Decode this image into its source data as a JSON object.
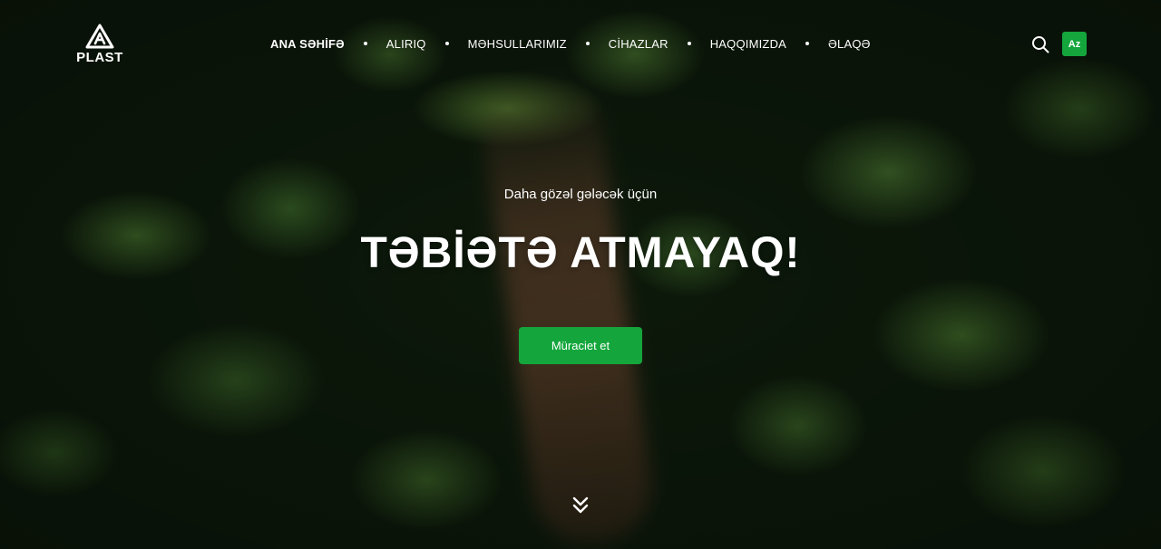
{
  "brand": {
    "name": "PLAST",
    "logo_icon": "recycle-a-triangle-icon"
  },
  "nav": {
    "items": [
      {
        "label": "ANA SƏHİFƏ",
        "active": true
      },
      {
        "label": "ALIRIQ",
        "active": false
      },
      {
        "label": "MƏHSULLARIMIZ",
        "active": false
      },
      {
        "label": "CİHAZLAR",
        "active": false
      },
      {
        "label": "HAQQIMIZDA",
        "active": false
      },
      {
        "label": "ƏLAQƏ",
        "active": false
      }
    ]
  },
  "header": {
    "search_icon": "search-icon",
    "language": "Az"
  },
  "hero": {
    "eyebrow": "Daha gözəl gələcək üçün",
    "headline": "TƏBİƏTƏ ATMAYAQ!",
    "cta_label": "Müraciet et",
    "scroll_icon": "chevrons-down-icon",
    "background": "aerial forest photo"
  },
  "colors": {
    "accent": "#14a63c",
    "text": "#ffffff"
  }
}
